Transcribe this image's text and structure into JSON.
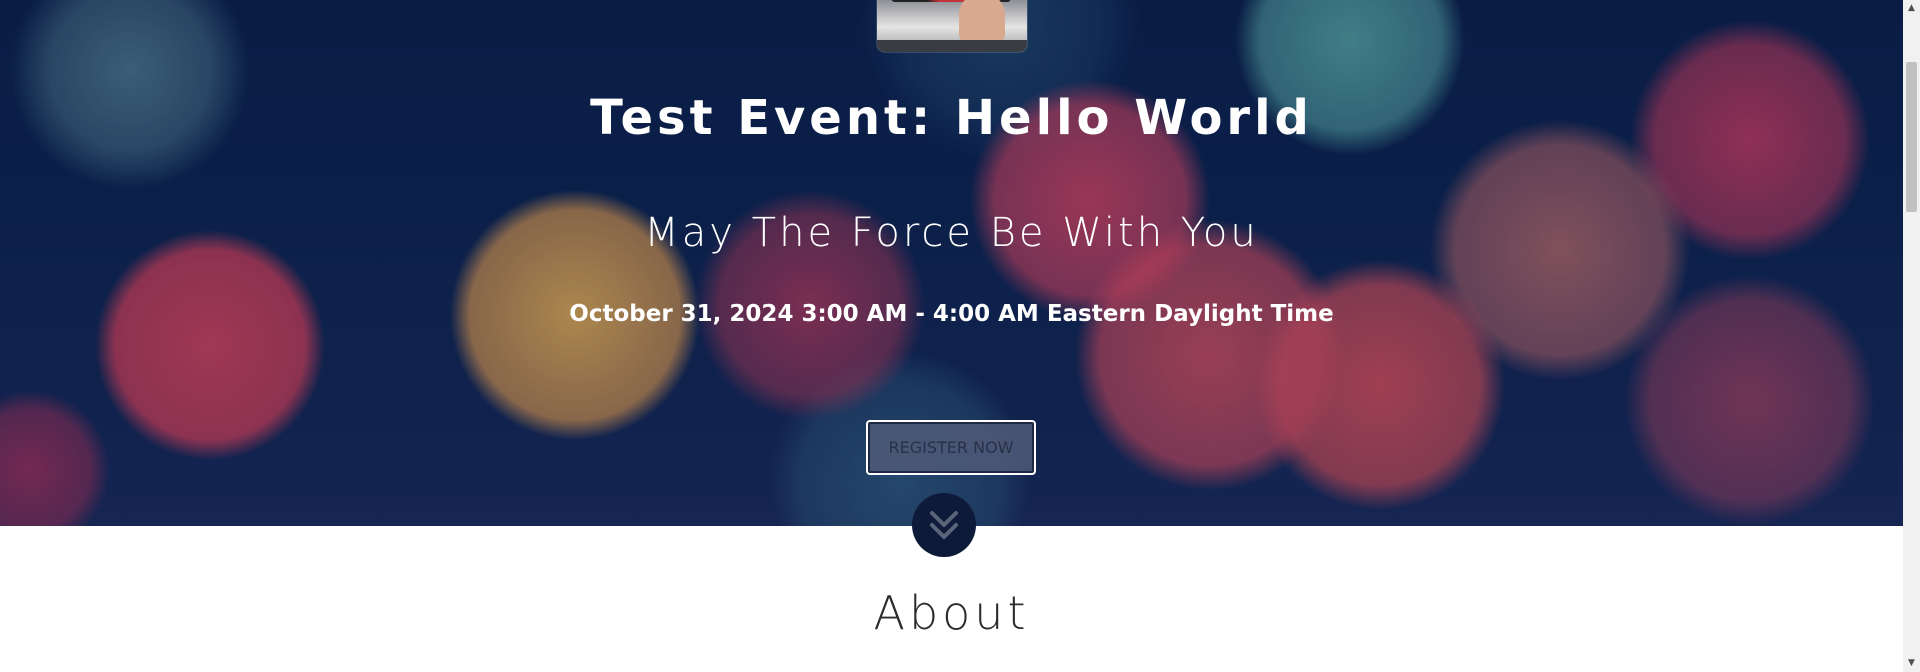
{
  "hero": {
    "title": "Test Event: Hello World",
    "subtitle": "May The Force Be With You",
    "date_time": "October 31, 2024 3:00 AM - 4:00 AM Eastern Daylight Time",
    "register_label": "REGISTER NOW",
    "scroll_icon": "chevron-double-down-icon",
    "thumbnail_icon": "event-image"
  },
  "about": {
    "heading": "About"
  },
  "scrollbar": {
    "up_arrow": "▲",
    "down_arrow": "▼",
    "scroll_position": 0.1
  },
  "colors": {
    "hero_base": "#0d2450",
    "button_bg": "#505a78",
    "button_border": "#ffffff",
    "scroll_button_bg": "#0e1a3a",
    "page_bg": "#ffffff",
    "about_text": "#2b2b2b"
  }
}
